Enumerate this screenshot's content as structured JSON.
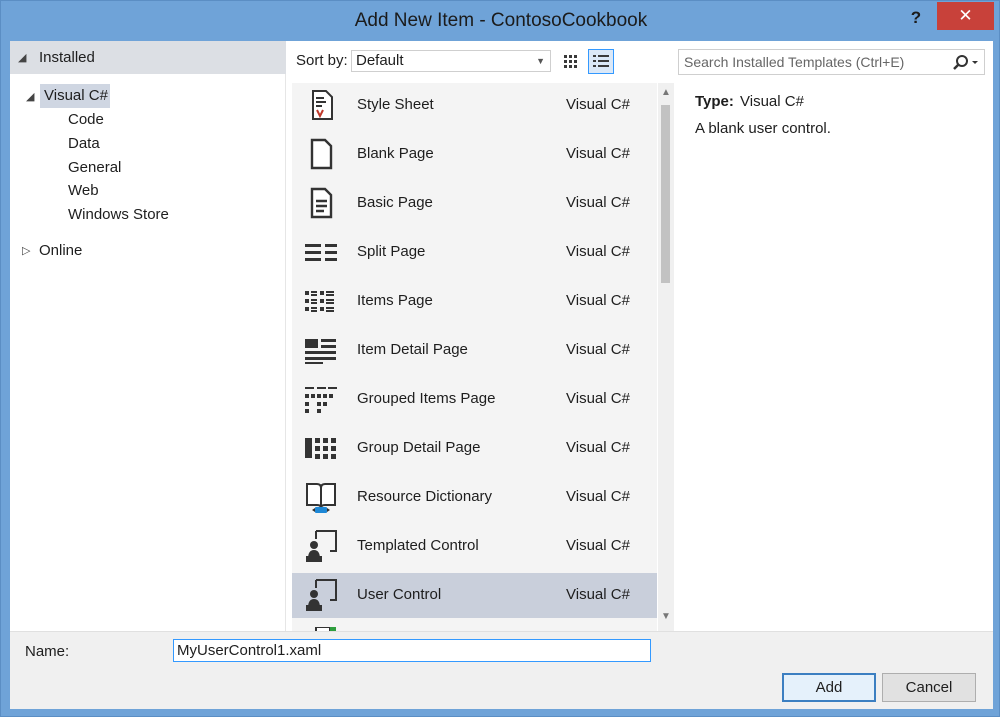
{
  "window": {
    "title": "Add New Item - ContosoCookbook",
    "help": "?",
    "close": "✕"
  },
  "tree": {
    "installed": "Installed",
    "visual_cs": "Visual C#",
    "children": [
      "Code",
      "Data",
      "General",
      "Web",
      "Windows Store"
    ],
    "online": "Online"
  },
  "toolbar": {
    "sort_label": "Sort by:",
    "sort_value": "Default"
  },
  "search": {
    "placeholder": "Search Installed Templates (Ctrl+E)"
  },
  "items": [
    {
      "name": "Style Sheet",
      "lang": "Visual C#",
      "icon": "style-sheet-icon"
    },
    {
      "name": "Blank Page",
      "lang": "Visual C#",
      "icon": "blank-page-icon"
    },
    {
      "name": "Basic Page",
      "lang": "Visual C#",
      "icon": "basic-page-icon"
    },
    {
      "name": "Split Page",
      "lang": "Visual C#",
      "icon": "split-page-icon"
    },
    {
      "name": "Items Page",
      "lang": "Visual C#",
      "icon": "items-page-icon"
    },
    {
      "name": "Item Detail Page",
      "lang": "Visual C#",
      "icon": "item-detail-page-icon"
    },
    {
      "name": "Grouped Items Page",
      "lang": "Visual C#",
      "icon": "grouped-items-page-icon"
    },
    {
      "name": "Group Detail Page",
      "lang": "Visual C#",
      "icon": "group-detail-page-icon"
    },
    {
      "name": "Resource Dictionary",
      "lang": "Visual C#",
      "icon": "resource-dictionary-icon"
    },
    {
      "name": "Templated Control",
      "lang": "Visual C#",
      "icon": "templated-control-icon"
    },
    {
      "name": "User Control",
      "lang": "Visual C#",
      "icon": "user-control-icon",
      "selected": true
    }
  ],
  "details": {
    "type_label": "Type:",
    "type_value": "Visual C#",
    "description": "A blank user control."
  },
  "bottom": {
    "name_label": "Name:",
    "name_value": "MyUserControl1.xaml",
    "add": "Add",
    "cancel": "Cancel"
  },
  "colors": {
    "accent": "#3399ff",
    "selection": "#c9cfdb",
    "close": "#c8413a",
    "titlebar": "#6fa3d8"
  }
}
